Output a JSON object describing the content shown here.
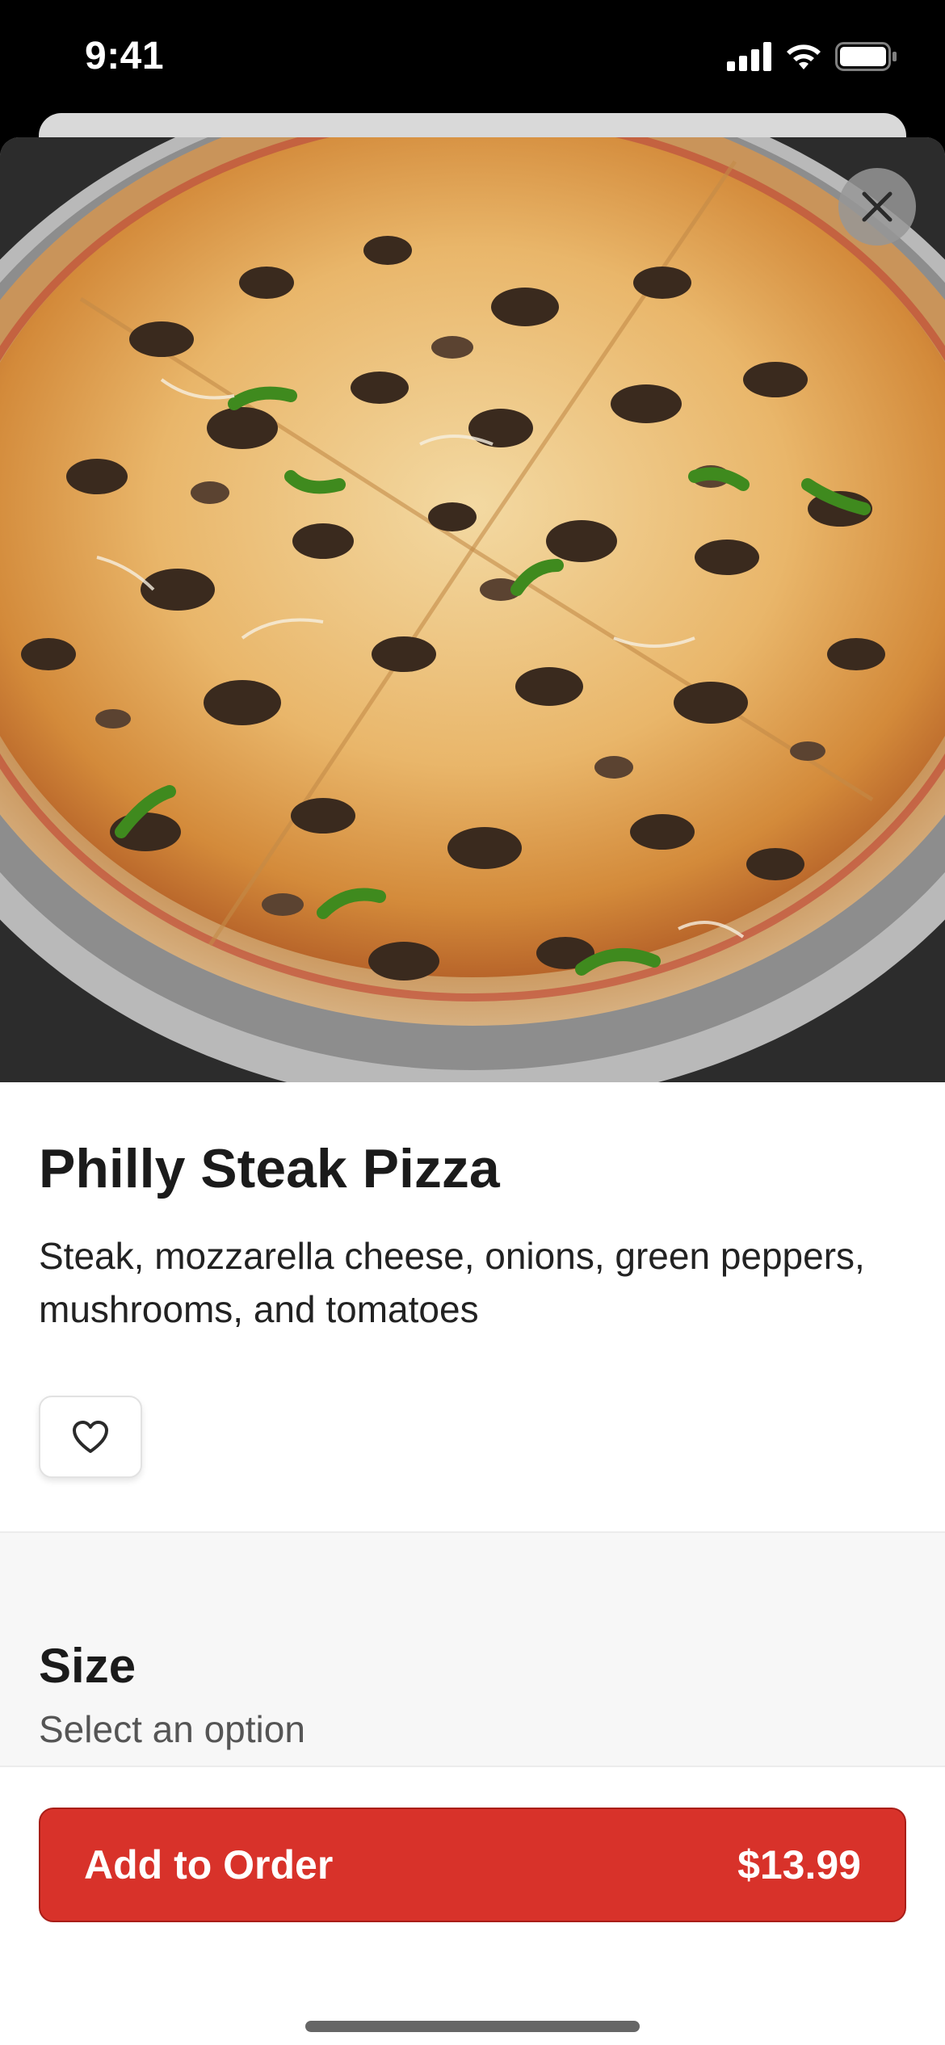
{
  "status_bar": {
    "time": "9:41"
  },
  "item": {
    "name": "Philly Steak Pizza",
    "description": "Steak, mozzarella cheese, onions, green peppers, mushrooms, and tomatoes",
    "image_alt": "Philly Steak Pizza photo"
  },
  "options": {
    "size_title": "Size",
    "size_subtitle": "Select an option"
  },
  "footer": {
    "add_label": "Add to Order",
    "price": "$13.99"
  },
  "colors": {
    "accent": "#d8322a",
    "sheet_bg": "#ffffff",
    "section_bg": "#f7f7f7"
  },
  "icons": {
    "close": "close-icon",
    "favorite": "heart-icon",
    "signal": "signal-icon",
    "wifi": "wifi-icon",
    "battery": "battery-icon"
  }
}
